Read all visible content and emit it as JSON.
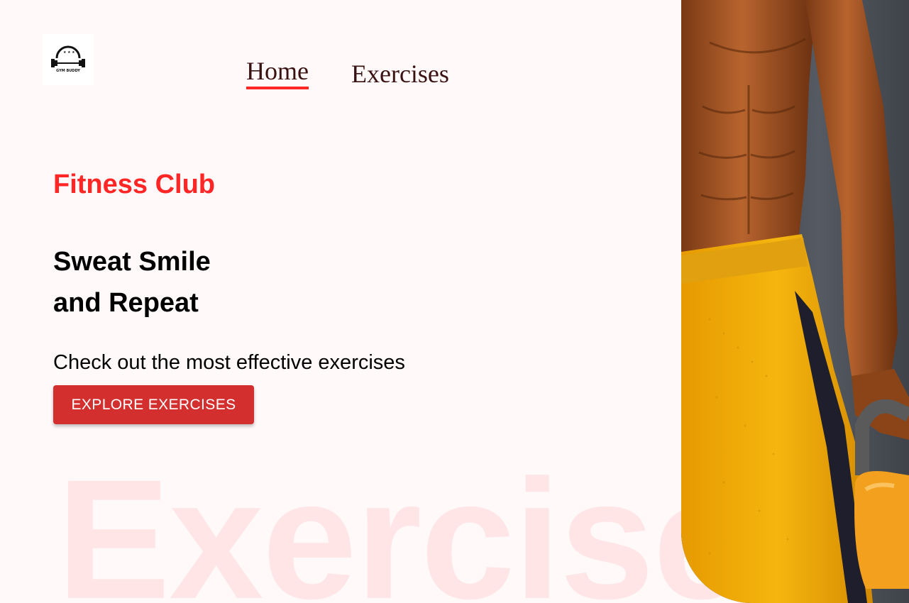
{
  "logo": {
    "brand": "GYM BUDDY",
    "icon": "dumbbell-logo-icon"
  },
  "nav": {
    "items": [
      {
        "label": "Home",
        "active": true
      },
      {
        "label": "Exercises",
        "active": false
      }
    ],
    "active_underline_color": "#ff2625"
  },
  "hero": {
    "subtitle": "Fitness Club",
    "headline_line1": "Sweat Smile",
    "headline_line2": "and Repeat",
    "tagline": "Check out the most effective exercises",
    "cta_label": "EXPLORE EXERCISES",
    "background_word": "Exercise",
    "image": "muscular-man-holding-kettlebell-photo"
  },
  "colors": {
    "accent": "#ff2625",
    "button": "#d32f2f",
    "page_background": "#fff9fa"
  }
}
